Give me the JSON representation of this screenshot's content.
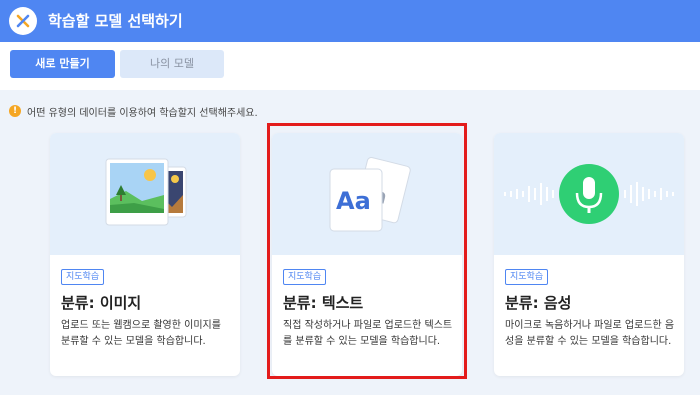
{
  "header": {
    "title": "학습할 모델 선택하기",
    "close_icon": "close-icon"
  },
  "tabs": [
    {
      "label": "새로 만들기",
      "active": true
    },
    {
      "label": "나의 모델",
      "active": false
    }
  ],
  "notice": {
    "text": "어떤 유형의 데이터를 이용하여 학습할지 선택해주세요.",
    "icon": "warning-icon"
  },
  "cards": [
    {
      "badge": "지도학습",
      "title": "분류: 이미지",
      "desc": "업로드 또는 웹캠으로 촬영한 이미지를 분류할 수 있는 모델을 학습합니다.",
      "icon": "image-icon"
    },
    {
      "badge": "지도학습",
      "title": "분류: 텍스트",
      "desc": "직접 작성하거나 파일로 업로드한 텍스트를 분류할 수 있는 모델을 학습합니다.",
      "icon": "text-icon",
      "glyph": "Aa",
      "selected": true
    },
    {
      "badge": "지도학습",
      "title": "분류: 음성",
      "desc": "마이크로 녹음하거나 파일로 업로드한 음성을 분류할 수 있는 모델을 학습합니다.",
      "icon": "microphone-icon"
    }
  ],
  "colors": {
    "primary": "#4f86f2",
    "highlight": "#e31b1b",
    "mic": "#2fcf74",
    "badge": "#4f86f2"
  }
}
